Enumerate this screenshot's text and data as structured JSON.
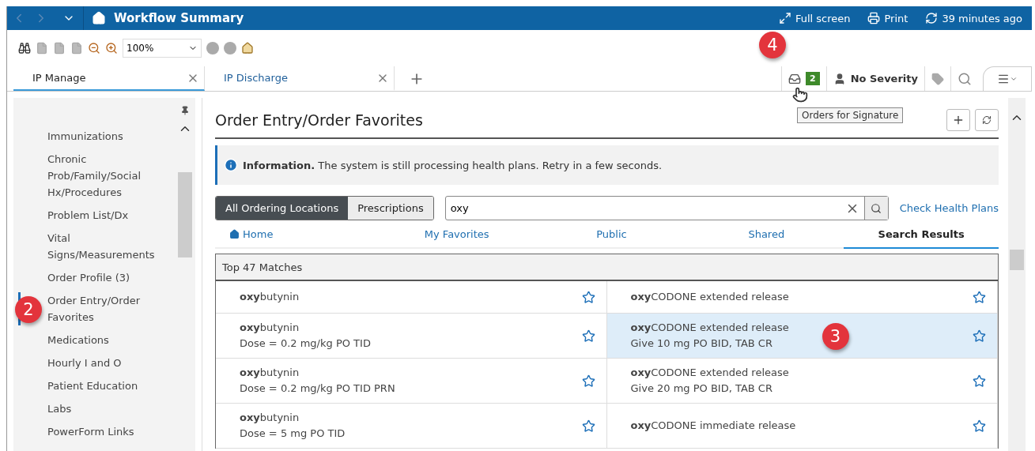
{
  "header": {
    "title": "Workflow Summary",
    "actions": [
      {
        "kind": "fullscreen",
        "label": "Full screen"
      },
      {
        "kind": "print",
        "label": "Print"
      },
      {
        "kind": "refresh",
        "label": "39 minutes ago"
      }
    ]
  },
  "toolbar": {
    "zoom": "100%"
  },
  "tabs": [
    {
      "label": "IP Manage",
      "selected": true
    },
    {
      "label": "IP Discharge",
      "selected": false
    }
  ],
  "tab_tools": {
    "orders_count": "2",
    "severity": "No Severity",
    "callout": "4",
    "tooltip": "Orders for Signature"
  },
  "sidebar": {
    "callout": "2",
    "items": [
      {
        "label": "Immunizations",
        "selected": false
      },
      {
        "label": "Chronic Prob/Family/Social Hx/Procedures",
        "selected": false
      },
      {
        "label": "Problem List/Dx",
        "selected": false
      },
      {
        "label": "Vital Signs/Measurements",
        "selected": false
      },
      {
        "label": "Order Profile (3)",
        "selected": false
      },
      {
        "label": "Order Entry/Order Favorites",
        "selected": true
      },
      {
        "label": "Medications",
        "selected": false
      },
      {
        "label": "Hourly I and O",
        "selected": false
      },
      {
        "label": "Patient Education",
        "selected": false
      },
      {
        "label": "Labs",
        "selected": false
      },
      {
        "label": "PowerForm Links",
        "selected": false
      }
    ]
  },
  "page": {
    "title": "Order Entry/Order Favorites",
    "info": "**Information.** The system is still processing health plans. Retry in a few seconds.",
    "locations": [
      {
        "label": "All Ordering Locations",
        "selected": true
      },
      {
        "label": "Prescriptions",
        "selected": false
      }
    ],
    "search": {
      "value": "oxy"
    },
    "check_link": "Check Health Plans",
    "nav": [
      {
        "label": "Home",
        "kind": "home",
        "selected": false
      },
      {
        "label": "My Favorites",
        "kind": "plain",
        "selected": false
      },
      {
        "label": "Public",
        "kind": "plain",
        "selected": false
      },
      {
        "label": "Shared",
        "kind": "plain",
        "selected": false
      },
      {
        "label": "Search Results",
        "kind": "plain",
        "selected": true
      }
    ],
    "results": {
      "title": "Top 47 Matches",
      "callout": "3",
      "rows": [
        {
          "cells": [
            {
              "name": "**oxy**butynin",
              "selected": false
            },
            {
              "name": "**oxy**CODONE extended release",
              "selected": false
            }
          ]
        },
        {
          "cells": [
            {
              "name": "**oxy**butynin",
              "detail": "Dose = 0.2 mg/kg PO TID",
              "selected": false
            },
            {
              "name": "**oxy**CODONE extended release",
              "detail": "Give 10 mg PO BID, TAB CR",
              "selected": true
            }
          ]
        },
        {
          "cells": [
            {
              "name": "**oxy**butynin",
              "detail": "Dose = 0.2 mg/kg PO TID PRN",
              "selected": false
            },
            {
              "name": "**oxy**CODONE extended release",
              "detail": "Give 20 mg PO BID, TAB CR",
              "selected": false
            }
          ]
        },
        {
          "cells": [
            {
              "name": "**oxy**butynin",
              "detail": "Dose = 5 mg PO TID",
              "selected": false
            },
            {
              "name": "**oxy**CODONE immediate release",
              "selected": false
            }
          ]
        }
      ]
    }
  }
}
